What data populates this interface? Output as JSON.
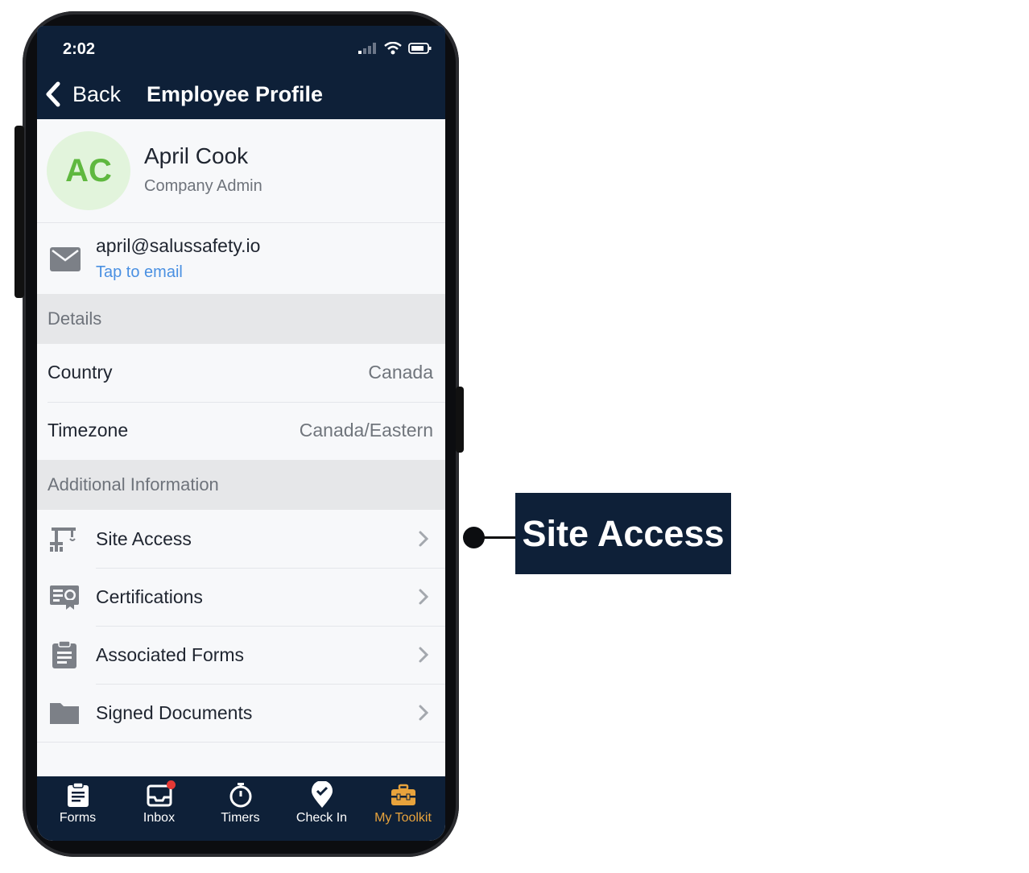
{
  "status_bar": {
    "time": "2:02"
  },
  "nav": {
    "back_label": "Back",
    "title": "Employee Profile"
  },
  "profile": {
    "initials": "AC",
    "name": "April Cook",
    "role": "Company Admin"
  },
  "email": {
    "address": "april@salussafety.io",
    "action": "Tap to email"
  },
  "sections": {
    "details": "Details",
    "additional": "Additional Information"
  },
  "details": [
    {
      "key": "Country",
      "value": "Canada"
    },
    {
      "key": "Timezone",
      "value": "Canada/Eastern"
    }
  ],
  "additional_items": [
    {
      "label": "Site Access",
      "icon": "crane-icon"
    },
    {
      "label": "Certifications",
      "icon": "certificate-icon"
    },
    {
      "label": "Associated Forms",
      "icon": "clipboard-icon"
    },
    {
      "label": "Signed Documents",
      "icon": "folder-icon"
    }
  ],
  "tabbar": [
    {
      "label": "Forms",
      "icon": "clipboard-icon"
    },
    {
      "label": "Inbox",
      "icon": "inbox-icon",
      "badge": true
    },
    {
      "label": "Timers",
      "icon": "stopwatch-icon"
    },
    {
      "label": "Check In",
      "icon": "location-check-icon"
    },
    {
      "label": "My Toolkit",
      "icon": "toolbox-icon",
      "active": true
    }
  ],
  "colors": {
    "navy": "#0e2038",
    "active_tab": "#e8a33c",
    "link": "#4a90e2",
    "avatar_text": "#5fb83f",
    "badge": "#e53935"
  },
  "callout": {
    "label": "Site Access"
  }
}
